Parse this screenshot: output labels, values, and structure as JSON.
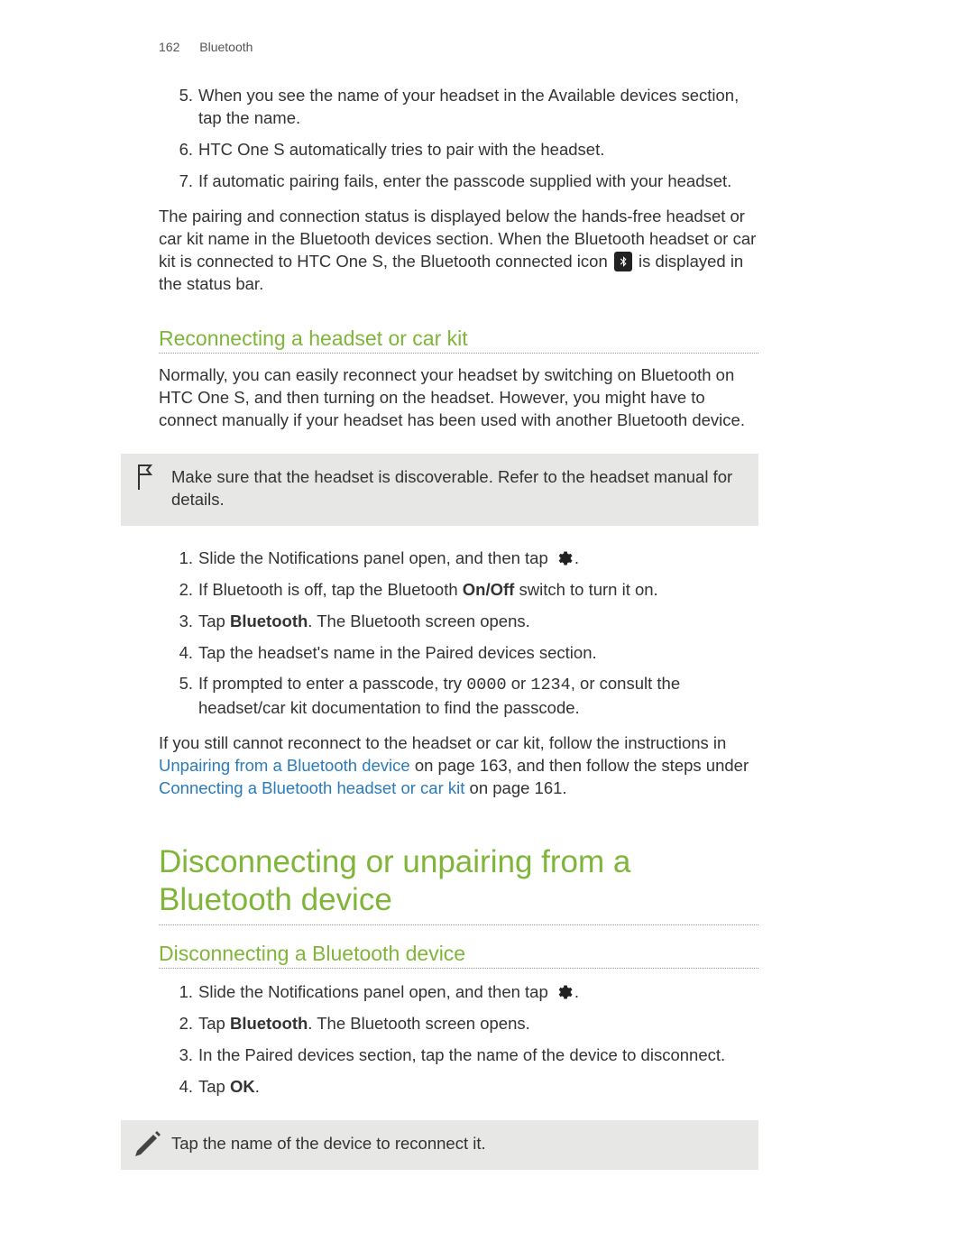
{
  "header": {
    "page_number": "162",
    "section": "Bluetooth"
  },
  "listA": {
    "items": [
      {
        "n": "5.",
        "text": "When you see the name of your headset in the Available devices section, tap the name."
      },
      {
        "n": "6.",
        "text": "HTC One S automatically tries to pair with the headset."
      },
      {
        "n": "7.",
        "text": "If automatic pairing fails, enter the passcode supplied with your headset."
      }
    ]
  },
  "paraA": {
    "before_icon": "The pairing and connection status is displayed below the hands-free headset or car kit name in the Bluetooth devices section. When the Bluetooth headset or car kit is connected to HTC One S, the Bluetooth connected icon ",
    "after_icon": " is displayed in the status bar."
  },
  "subhead1": "Reconnecting a headset or car kit",
  "paraB": "Normally, you can easily reconnect your headset by switching on Bluetooth on HTC One S, and then turning on the headset. However, you might have to connect manually if your headset has been used with another Bluetooth device.",
  "callout1": "Make sure that the headset is discoverable. Refer to the headset manual for details.",
  "listB": {
    "i1_before": "Slide the Notifications panel open, and then tap ",
    "i1_after": ".",
    "i2_before": "If Bluetooth is off, tap the Bluetooth ",
    "i2_bold": "On/Off",
    "i2_after": " switch to turn it on.",
    "i3_before": "Tap ",
    "i3_bold": "Bluetooth",
    "i3_after": ". The Bluetooth screen opens.",
    "i4": "Tap the headset's name in the Paired devices section.",
    "i5_before": "If prompted to enter a passcode, try ",
    "i5_code1": "0000",
    "i5_mid": " or ",
    "i5_code2": "1234",
    "i5_after": ", or consult the headset/car kit documentation to find the passcode."
  },
  "paraC": {
    "t1": "If you still cannot reconnect to the headset or car kit, follow the instructions in ",
    "link1": "Unpairing from a Bluetooth device",
    "t2": " on page 163, and then follow the steps under ",
    "link2": "Connecting a Bluetooth headset or car kit",
    "t3": " on page 161."
  },
  "mainhead": "Disconnecting or unpairing from a Bluetooth device",
  "subhead2": "Disconnecting a Bluetooth device",
  "listC": {
    "i1_before": "Slide the Notifications panel open, and then tap ",
    "i1_after": ".",
    "i2_before": "Tap ",
    "i2_bold": "Bluetooth",
    "i2_after": ". The Bluetooth screen opens.",
    "i3": "In the Paired devices section, tap the name of the device to disconnect.",
    "i4_before": "Tap ",
    "i4_bold": "OK",
    "i4_after": "."
  },
  "callout2": "Tap the name of the device to reconnect it.",
  "nums": {
    "n1": "1.",
    "n2": "2.",
    "n3": "3.",
    "n4": "4.",
    "n5": "5."
  }
}
